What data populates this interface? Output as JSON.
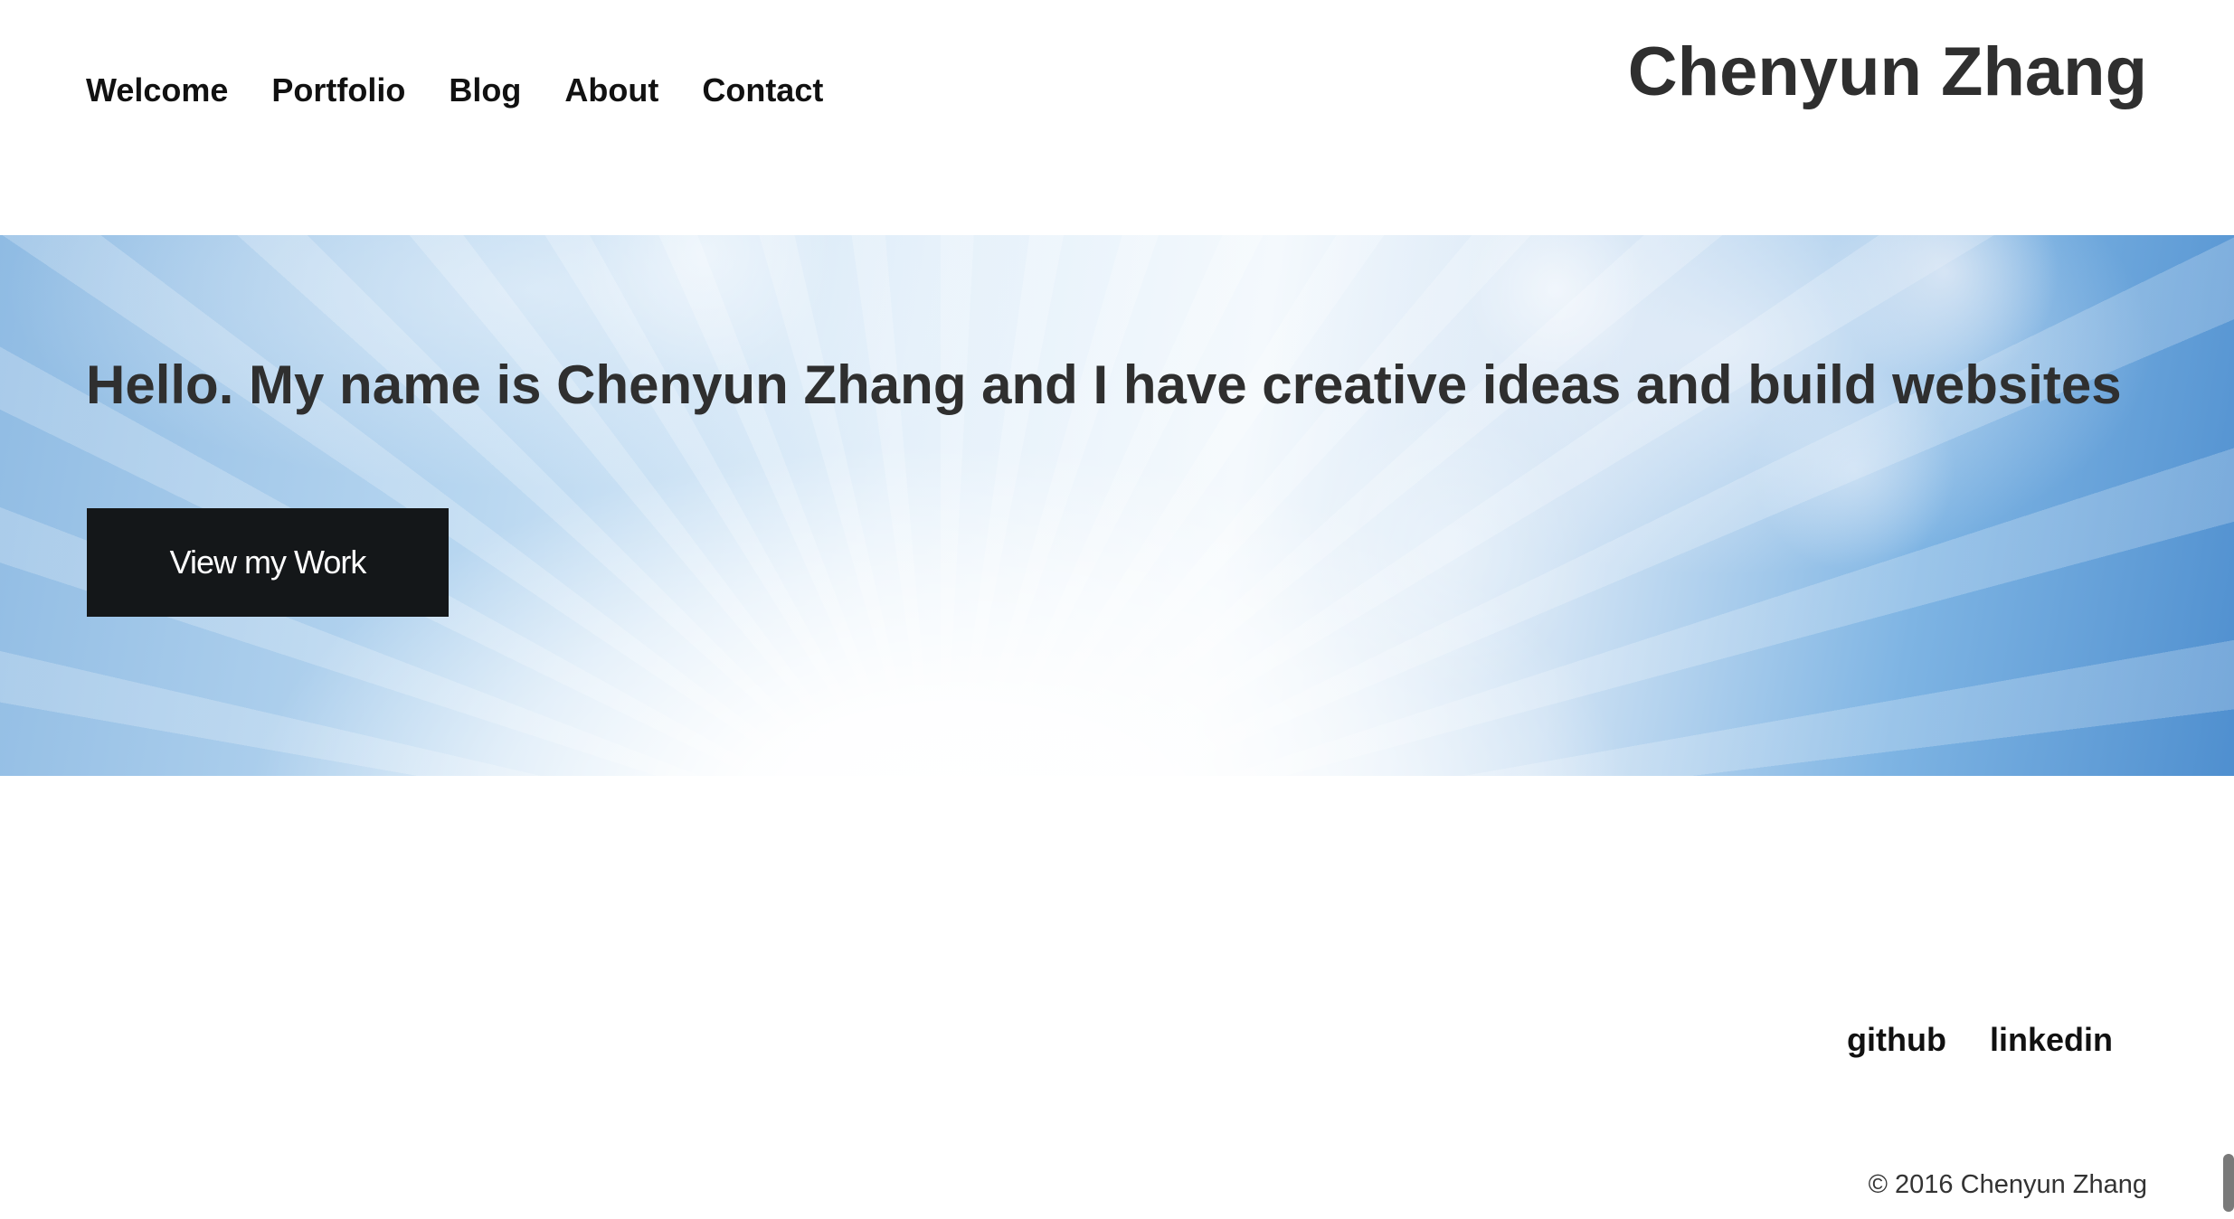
{
  "header": {
    "site_title": "Chenyun Zhang",
    "nav": [
      {
        "label": "Welcome"
      },
      {
        "label": "Portfolio"
      },
      {
        "label": "Blog"
      },
      {
        "label": "About"
      },
      {
        "label": "Contact"
      }
    ]
  },
  "hero": {
    "headline": "Hello. My name is Chenyun Zhang and I have creative ideas and build websites",
    "cta_label": "View my Work"
  },
  "footer": {
    "social": [
      {
        "label": "github"
      },
      {
        "label": "linkedin"
      }
    ],
    "copyright": "© 2016 Chenyun Zhang"
  },
  "colors": {
    "text_dark": "#2f2f2f",
    "nav_text": "#111111",
    "button_bg": "#141719",
    "button_text": "#ffffff",
    "sky_blue": "#7eb4e3"
  }
}
